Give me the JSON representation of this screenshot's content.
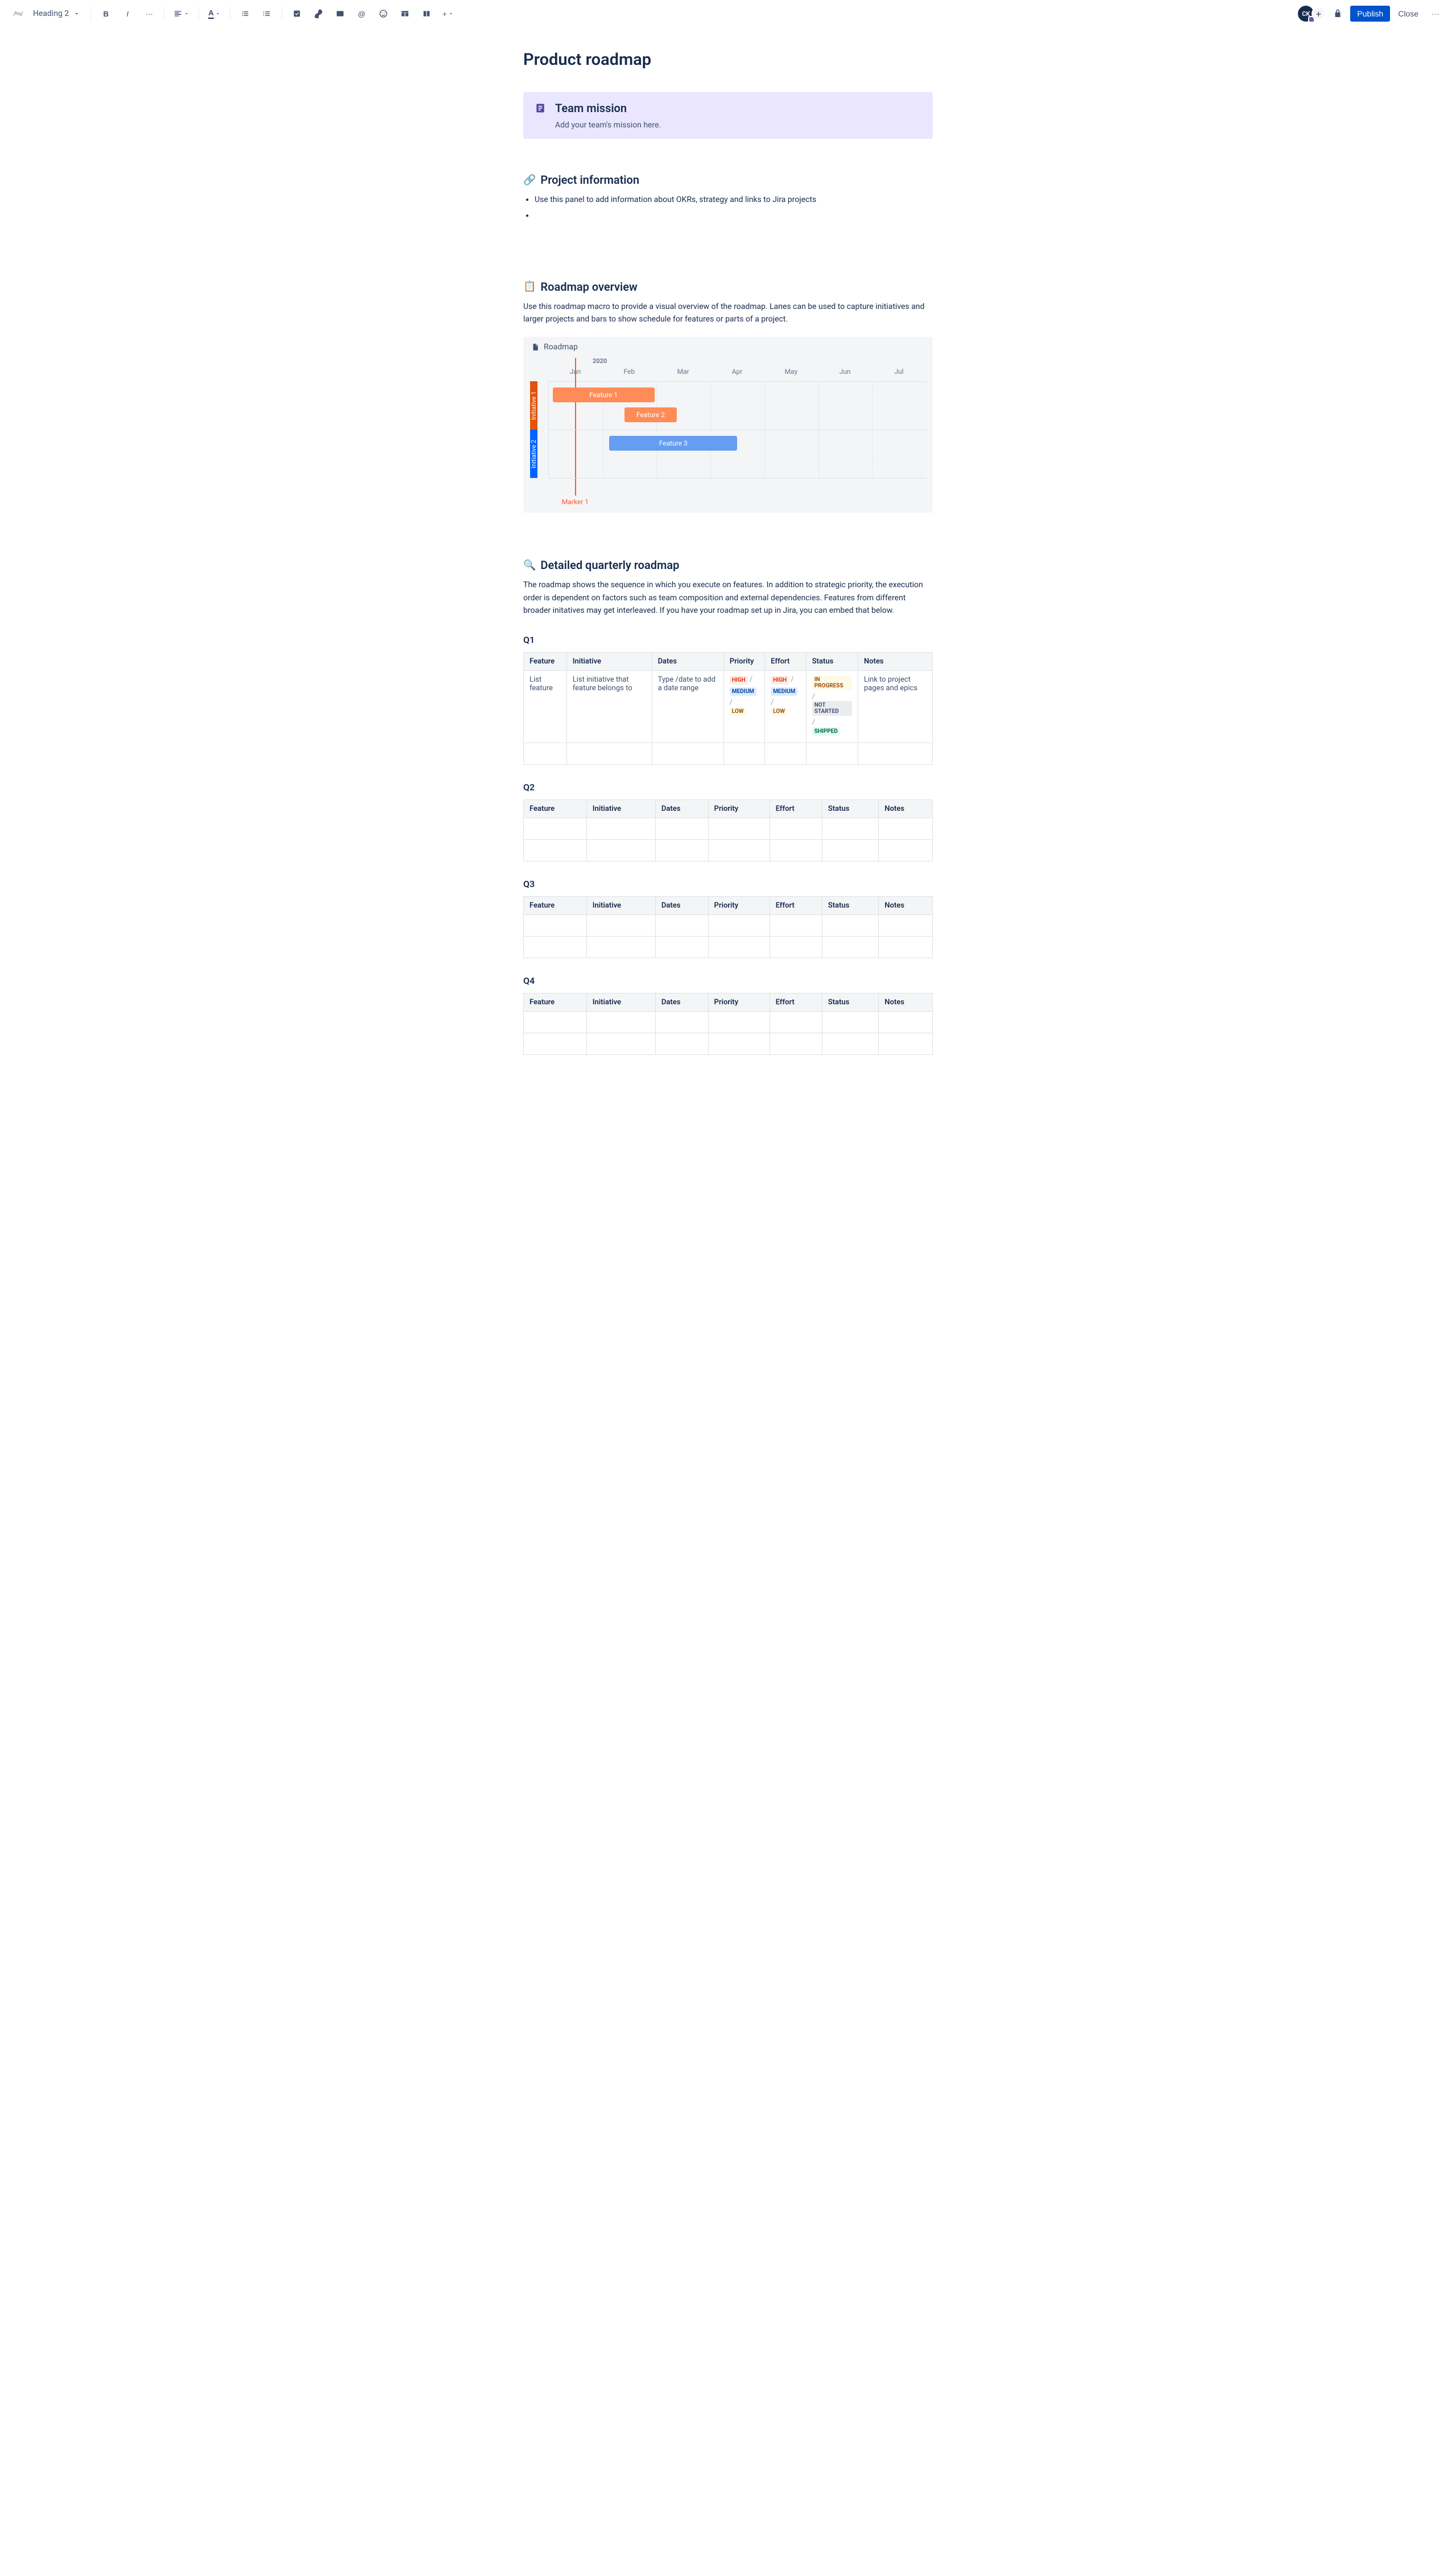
{
  "toolbar": {
    "style_label": "Heading 2",
    "avatar_initials": "CK",
    "publish_label": "Publish",
    "close_label": "Close"
  },
  "page": {
    "title": "Product roadmap"
  },
  "mission": {
    "title": "Team mission",
    "text": "Add your team's mission here."
  },
  "project_info": {
    "heading": "Project information",
    "bullets": [
      "Use this panel to add information about OKRs, strategy and links to Jira projects"
    ]
  },
  "overview": {
    "heading": "Roadmap overview",
    "desc": "Use this roadmap macro to provide a visual overview of the roadmap. Lanes can be used to capture initiatives and larger projects and bars to show schedule for features or parts of a project.",
    "macro_title": "Roadmap",
    "year": "2020",
    "months": [
      "Jan",
      "Feb",
      "Mar",
      "Apr",
      "May",
      "Jun",
      "Jul"
    ],
    "lanes": [
      "Initiative 1",
      "Initiative 2"
    ],
    "bars": {
      "f1": "Feature 1",
      "f2": "Feature 2",
      "f3": "Feature 3"
    },
    "marker": "Marker 1"
  },
  "detailed": {
    "heading": "Detailed quarterly roadmap",
    "desc": "The roadmap shows the sequence in which you execute on features. In addition to strategic priority, the execution order is dependent on factors such as team composition and external dependencies. Features from different broader initatives may get interleaved. If you have your roadmap set up in Jira, you can embed that below."
  },
  "columns": [
    "Feature",
    "Initiative",
    "Dates",
    "Priority",
    "Effort",
    "Status",
    "Notes"
  ],
  "quarters": [
    "Q1",
    "Q2",
    "Q3",
    "Q4"
  ],
  "q1row": {
    "feature": "List feature",
    "initiative": "List initiative that feature belongs to",
    "dates": "Type /date to add a date range",
    "notes": "Link to project pages and epics"
  },
  "lozenges": {
    "high": "HIGH",
    "medium": "MEDIUM",
    "low": "LOW",
    "inprogress": "IN PROGRESS",
    "notstarted": "NOT STARTED",
    "shipped": "SHIPPED"
  },
  "chart_data": {
    "type": "gantt",
    "year": 2020,
    "x_categories": [
      "Jan",
      "Feb",
      "Mar",
      "Apr",
      "May",
      "Jun",
      "Jul"
    ],
    "lanes": [
      {
        "name": "Initiative 1",
        "color": "#FF8B57",
        "bars": [
          {
            "label": "Feature 1",
            "start": "Jan",
            "end": "Feb"
          },
          {
            "label": "Feature 2",
            "start": "mid-Feb",
            "end": "mid-Mar"
          }
        ]
      },
      {
        "name": "Initiative 2",
        "color": "#669DF1",
        "bars": [
          {
            "label": "Feature 3",
            "start": "Feb",
            "end": "Apr"
          }
        ]
      }
    ],
    "markers": [
      {
        "label": "Marker 1",
        "at": "mid-Jan"
      }
    ]
  }
}
